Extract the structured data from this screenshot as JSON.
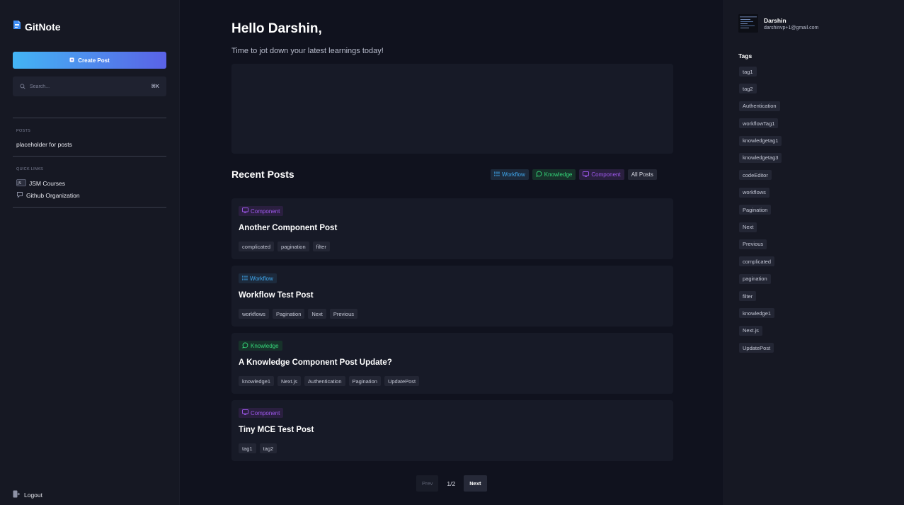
{
  "app": {
    "name": "GitNote"
  },
  "sidebar": {
    "create_label": "Create Post",
    "search_placeholder": "Search...",
    "search_shortcut": "⌘K",
    "posts_label": "POSTS",
    "posts_placeholder": "placeholder for posts",
    "quick_links_label": "QUICK LINKS",
    "quick_links": [
      {
        "label": "JSM Courses",
        "icon": "jsm-icon"
      },
      {
        "label": "Github Organization",
        "icon": "github-icon"
      }
    ],
    "logout_label": "Logout"
  },
  "main": {
    "greeting": "Hello Darshin,",
    "subtitle": "Time to jot down your latest learnings today!",
    "recent_title": "Recent Posts",
    "filters": [
      {
        "label": "Workflow",
        "icon": "list-icon"
      },
      {
        "label": "Knowledge",
        "icon": "chat-bubble-icon"
      },
      {
        "label": "Component",
        "icon": "monitor-icon"
      },
      {
        "label": "All Posts"
      }
    ],
    "posts": [
      {
        "type": "Component",
        "title": "Another Component Post",
        "tags": [
          "complicated",
          "pagination",
          "filter"
        ]
      },
      {
        "type": "Workflow",
        "title": "Workflow Test Post",
        "tags": [
          "workflows",
          "Pagination",
          "Next",
          "Previous"
        ]
      },
      {
        "type": "Knowledge",
        "title": "A Knowledge Component Post Update?",
        "tags": [
          "knowledge1",
          "Next.js",
          "Authentication",
          "Pagination",
          "UpdatePost"
        ]
      },
      {
        "type": "Component",
        "title": "Tiny MCE Test Post",
        "tags": [
          "tag1",
          "tag2"
        ]
      }
    ],
    "pagination": {
      "prev": "Prev",
      "page": "1/2",
      "next": "Next"
    }
  },
  "user": {
    "name": "Darshin",
    "email": "darshinvp+1@gmail.com"
  },
  "tags_panel": {
    "title": "Tags",
    "tags": [
      "tag1",
      "tag2",
      "Authentication",
      "workflowTag1",
      "knowledgetag1",
      "knowledgetag3",
      "codeEditor",
      "workflows",
      "Pagination",
      "Next",
      "Previous",
      "complicated",
      "pagination",
      "filter",
      "knowledge1",
      "Next.js",
      "UpdatePost"
    ]
  },
  "colors": {
    "workflow": "#3fa8ef",
    "knowledge": "#35d97a",
    "component": "#a15af0",
    "create_gradient_start": "#43b5f5",
    "create_gradient_end": "#5a62e6"
  }
}
